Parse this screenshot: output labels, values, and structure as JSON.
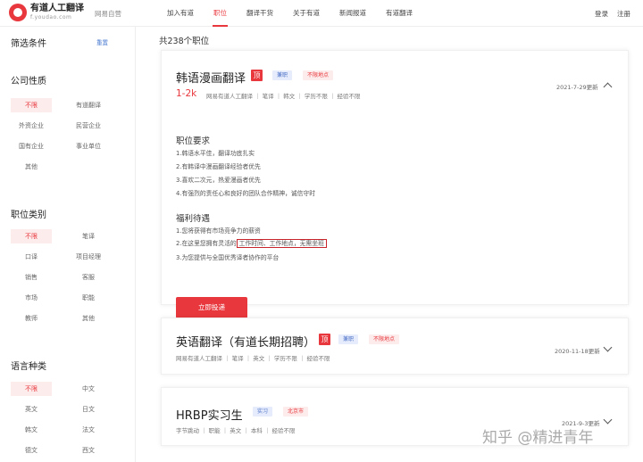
{
  "header": {
    "logo_title": "有道人工翻译",
    "logo_sub": "f.youdao.com",
    "brand_tag": "网易自营",
    "nav": [
      "加入有道",
      "职位",
      "翻译干货",
      "关于有道",
      "新闻报道",
      "有道翻译"
    ],
    "active_nav": "职位",
    "login": "登录",
    "register": "注册"
  },
  "sidebar": {
    "title": "筛选条件",
    "reset": "重置",
    "groups": [
      {
        "title": "公司性质",
        "options": [
          "不限",
          "有道翻译",
          "外资企业",
          "民营企业",
          "国有企业",
          "事业单位",
          "其他"
        ]
      },
      {
        "title": "职位类别",
        "options": [
          "不限",
          "笔译",
          "口译",
          "项目经理",
          "销售",
          "客服",
          "市场",
          "职能",
          "教师",
          "其他"
        ]
      },
      {
        "title": "语言种类",
        "options": [
          "不限",
          "中文",
          "英文",
          "日文",
          "韩文",
          "法文",
          "德文",
          "西文"
        ]
      }
    ]
  },
  "main": {
    "count_text": "共238个职位",
    "jobs": [
      {
        "title": "韩语漫画翻译",
        "top": "顶",
        "tags": [
          "兼职",
          "不限地点"
        ],
        "salary": "1-2k",
        "meta": "网易有道人工翻译 ｜ 笔译 ｜ 韩文 ｜ 学历不限 ｜ 经验不限",
        "date": "2021-7-29更新",
        "req_title": "职位要求",
        "requirements": [
          "1.韩语水平佳，翻译功底扎实",
          "2.有韩译中漫画翻译经验者优先",
          "3.喜欢二次元，热爱漫画者优先",
          "4.有强烈的责任心和良好的团队合作精神，诚信守时"
        ],
        "benefit_title": "福利待遇",
        "benefits": [
          "1.您将获得有市场竞争力的薪资",
          "2.在这里您拥有灵活的",
          "3.为您提供与全国优秀译者协作的平台"
        ],
        "benefit_highlight": "工作时间、工作地点，无需坐班",
        "apply": "立即投递"
      },
      {
        "title": "英语翻译（有道长期招聘）",
        "top": "顶",
        "tags": [
          "兼职",
          "不限地点"
        ],
        "meta": "网易有道人工翻译 ｜ 笔译 ｜ 英文 ｜ 学历不限 ｜ 经验不限",
        "date": "2020-11-18更新"
      },
      {
        "title": "HRBP实习生",
        "tags": [
          "实习",
          "北京市"
        ],
        "meta": "字节跳动 ｜ 职能 ｜ 英文 ｜ 本科 ｜ 经验不限",
        "date": "2021-9-3更新"
      }
    ]
  },
  "watermark": "知乎 @精进青年",
  "colors": {
    "accent": "#e8383d",
    "tag_blue": "#4a6fc7"
  }
}
